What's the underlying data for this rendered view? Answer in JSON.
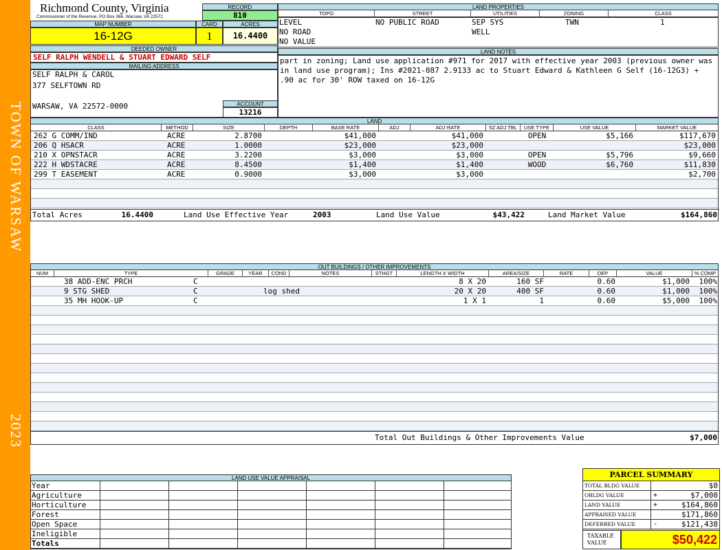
{
  "sidebar": {
    "town": "TOWN OF WARSAW",
    "year": "2023"
  },
  "header": {
    "county": "Richmond County, Virginia",
    "commissioner": "Commissioner of the Revenue, PO Box 366, Warsaw, VA 22572"
  },
  "record": {
    "label": "RECORD",
    "value": "810"
  },
  "map": {
    "label": "MAP NUMBER",
    "value": "16-12G"
  },
  "card": {
    "label": "CARD",
    "value": "1"
  },
  "acres": {
    "label": "ACRES",
    "value": "16.4400"
  },
  "owner": {
    "deeded_label": "DEEDED OWNER",
    "deeded": "SELF RALPH WENDELL & STUART EDWARD SELF",
    "mailing_label": "MAILING ADDRESS",
    "line1": "SELF RALPH & CAROL",
    "line2": "377 SELFTOWN RD",
    "line3": "WARSAW, VA 22572-0000"
  },
  "account": {
    "label": "ACCOUNT",
    "value": "13216"
  },
  "land_props": {
    "title": "LAND PROPERTIES",
    "headers": [
      "TOPO",
      "STREET",
      "UTILITIES",
      "ZONING",
      "CLASS"
    ],
    "topo": [
      "LEVEL",
      "NO ROAD",
      "NO VALUE"
    ],
    "street": "NO PUBLIC ROAD",
    "utilities": [
      "SEP SYS",
      "WELL"
    ],
    "zoning": "TWN",
    "class": "1"
  },
  "land_notes": {
    "title": "LAND NOTES",
    "text": "part in zoning; Land use application #971 for 2017 with effective year 2003 (previous owner was in land use program); Ins #2021-087 2.9133 ac to Stuart Edward & Kathleen G Self (16-12G3) + .90 ac for 30' ROW taxed on 16-12G"
  },
  "land": {
    "title": "LAND",
    "headers": [
      "CLASS",
      "METHOD",
      "SIZE",
      "DEPTH",
      "BASE RATE",
      "ADJ",
      "ADJ RATE",
      "SZ ADJ TBL",
      "USE TYPE",
      "USE VALUE",
      "MARKET VALUE"
    ],
    "rows": [
      {
        "class": "262 G COMM/IND",
        "method": "ACRE",
        "size": "2.8700",
        "base": "$41,000",
        "adjrate": "$41,000",
        "usetype": "OPEN",
        "usevalue": "$5,166",
        "market": "$117,670"
      },
      {
        "class": "206 Q HSACR",
        "method": "ACRE",
        "size": "1.0000",
        "base": "$23,000",
        "adjrate": "$23,000",
        "usetype": "",
        "usevalue": "",
        "market": "$23,000"
      },
      {
        "class": "210 X OPNSTACR",
        "method": "ACRE",
        "size": "3.2200",
        "base": "$3,000",
        "adjrate": "$3,000",
        "usetype": "OPEN",
        "usevalue": "$5,796",
        "market": "$9,660"
      },
      {
        "class": "222 H WDSTACRE",
        "method": "ACRE",
        "size": "8.4500",
        "base": "$1,400",
        "adjrate": "$1,400",
        "usetype": "WOOD",
        "usevalue": "$6,760",
        "market": "$11,830"
      },
      {
        "class": "299 T EASEMENT",
        "method": "ACRE",
        "size": "0.9000",
        "base": "$3,000",
        "adjrate": "$3,000",
        "usetype": "",
        "usevalue": "",
        "market": "$2,700"
      }
    ],
    "total_acres_label": "Total Acres",
    "total_acres": "16.4400",
    "effective_label": "Land Use Effective Year",
    "effective": "2003",
    "use_value_label": "Land Use Value",
    "use_value": "$43,422",
    "market_label": "Land Market Value",
    "market": "$164,860"
  },
  "outbuildings": {
    "title": "OUT BUILDINGS / OTHER IMPROVEMENTS",
    "headers": [
      "NUM",
      "TYPE",
      "GRADE",
      "YEAR",
      "COND",
      "NOTES",
      "STHGT",
      "LENGTH X WIDTH",
      "AREA/SIZE",
      "RATE",
      "DEP",
      "VALUE",
      "% COMP"
    ],
    "rows": [
      {
        "type": "38 ADD-ENC PRCH",
        "grade": "C",
        "notes": "",
        "lw": "8 X 20",
        "area": "160 SF",
        "dep": "0.60",
        "value": "$1,000",
        "comp": "100%"
      },
      {
        "type": "9 STG SHED",
        "grade": "C",
        "notes": "log shed",
        "lw": "20 X 20",
        "area": "400 SF",
        "dep": "0.60",
        "value": "$1,000",
        "comp": "100%"
      },
      {
        "type": "35 MH HOOK-UP",
        "grade": "C",
        "notes": "",
        "lw": "1 X 1",
        "area": "1",
        "dep": "0.60",
        "value": "$5,000",
        "comp": "100%"
      }
    ],
    "total_label": "Total Out Buildings & Other Improvements Value",
    "total": "$7,000"
  },
  "luva": {
    "title": "LAND USE VALUE APPRAISAL",
    "rows": [
      "Year",
      "Agriculture",
      "Horticulture",
      "Forest",
      "Open Space",
      "Ineligible",
      "Totals"
    ]
  },
  "summary": {
    "title": "PARCEL SUMMARY",
    "rows": [
      {
        "label": "TOTAL BLDG VALUE",
        "sign": "",
        "value": "$0"
      },
      {
        "label": "OBLDG VALUE",
        "sign": "+",
        "value": "$7,000"
      },
      {
        "label": "LAND VALUE",
        "sign": "+",
        "value": "$164,860"
      },
      {
        "label": "APPRAISED VALUE",
        "sign": "",
        "value": "$171,860"
      },
      {
        "label": "DEFERRED VALUE",
        "sign": "-",
        "value": "$121,438"
      }
    ],
    "taxable_label": "TAXABLE VALUE",
    "taxable": "$50,422"
  },
  "colors": {
    "band": "#FF9900",
    "header": "#B9DEE9",
    "highlight": "#FFFF00",
    "record": "#90EE90",
    "owner_red": "#CC0000"
  }
}
